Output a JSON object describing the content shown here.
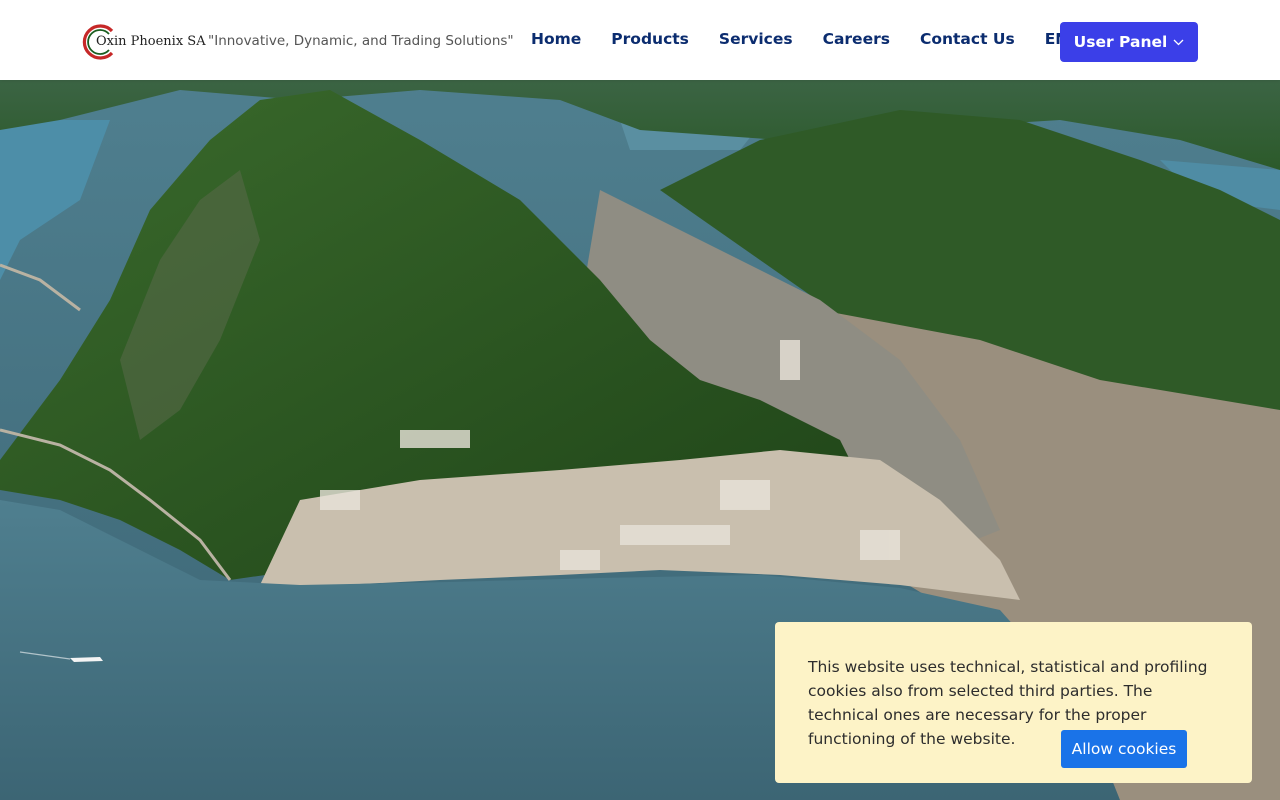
{
  "brand": {
    "name": "Oxin Phoenix SA",
    "tagline": "\"Innovative, Dynamic, and Trading Solutions\"",
    "logo_colors": {
      "red": "#c62828",
      "green": "#1b5e20"
    }
  },
  "nav": {
    "items": [
      {
        "label": "Home"
      },
      {
        "label": "Products"
      },
      {
        "label": "Services"
      },
      {
        "label": "Careers"
      },
      {
        "label": "Contact Us"
      }
    ],
    "language": "EN",
    "user_panel_label": "User Panel",
    "link_color": "#0b2c6f",
    "accent": "#3b3fe8"
  },
  "hero": {
    "icon": "landscape-photo"
  },
  "cookie_banner": {
    "message": "This website uses technical, statistical and profiling cookies also from selected third parties. The technical ones are necessary for the proper functioning of the website.",
    "button_label": "Allow cookies",
    "background": "#fdf3c7",
    "button_color": "#1a73e8"
  }
}
